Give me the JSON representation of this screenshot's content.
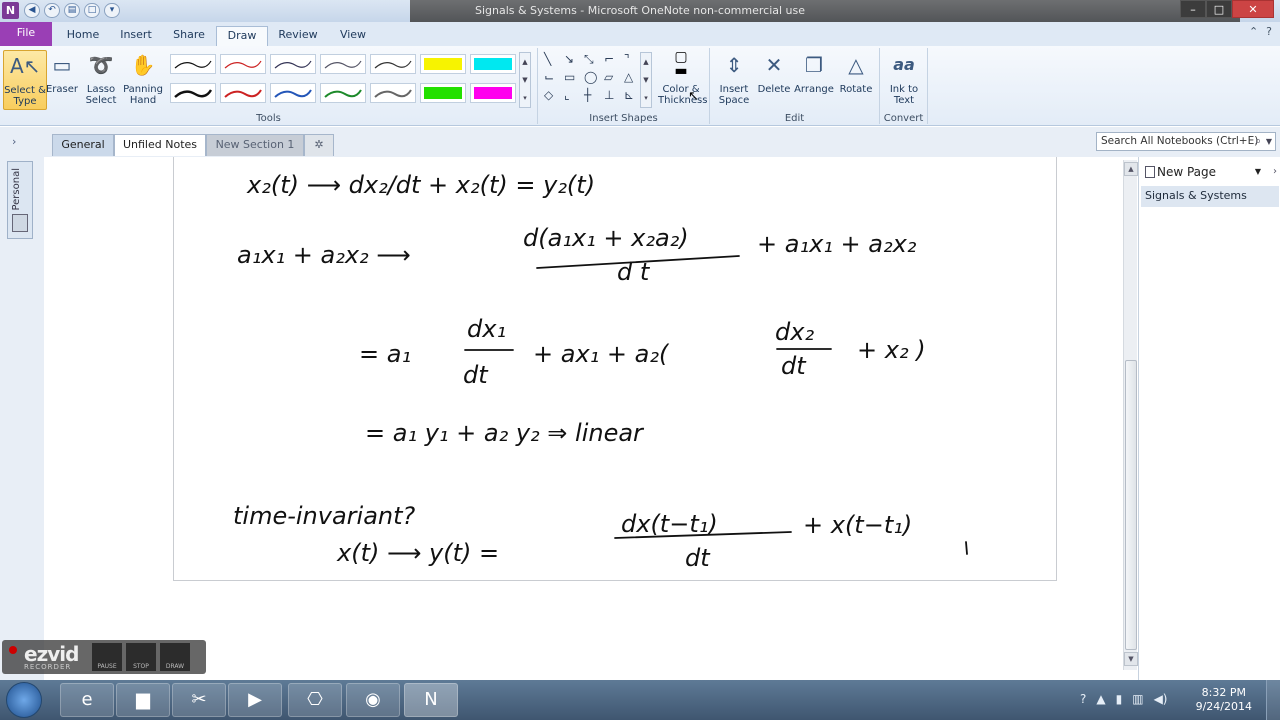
{
  "window": {
    "title": "Signals & Systems - Microsoft OneNote non-commercial use",
    "app_icon": "N"
  },
  "ribbon_tabs": [
    "File",
    "Home",
    "Insert",
    "Share",
    "Draw",
    "Review",
    "View"
  ],
  "active_tab": "Draw",
  "tools_group": {
    "label": "Tools",
    "select_type": "Select & Type",
    "eraser": "Eraser",
    "lasso_select": "Lasso Select",
    "panning_hand": "Panning Hand"
  },
  "insert_shapes_group": {
    "label": "Insert Shapes",
    "color_thickness": "Color & Thickness"
  },
  "edit_group": {
    "label": "Edit",
    "insert_space": "Insert Space",
    "delete": "Delete",
    "arrange": "Arrange",
    "rotate": "Rotate"
  },
  "convert_group": {
    "label": "Convert",
    "ink_to_text": "Ink to Text",
    "ink_icon_text": "aa"
  },
  "section_tabs": {
    "general": "General",
    "unfiled": "Unfiled Notes",
    "new_section": "New Section 1",
    "add": "✲"
  },
  "search": {
    "placeholder": "Search All Notebooks (Ctrl+E)"
  },
  "notebook_rail": {
    "label": "Personal"
  },
  "page_list": {
    "new_page": "New Page",
    "pages": [
      "Signals & Systems"
    ]
  },
  "ink_lines": [
    "x₂(t) ⟶ dx₂/dt + x₂(t) = y₂(t)",
    "a₁x₁ + a₂x₂ ⟶",
    "d(a₁x₁ + x₂a₂)",
    "d t",
    "+ a₁x₁ + a₂x₂",
    "= a₁",
    "dx₁",
    "dt",
    "+  ax₁ + a₂(",
    "dx₂",
    "dt",
    "+ x₂ )",
    "= a₁ y₁ + a₂ y₂ ⇒ linear",
    "time-invariant?",
    "x(t) ⟶ y(t) =",
    "dx(t−t₁)",
    "dt",
    "+  x(t−t₁)"
  ],
  "ezvid": {
    "logo": "ezvid",
    "sub": "RECORDER",
    "buttons": [
      "PAUSE",
      "STOP",
      "DRAW"
    ]
  },
  "taskbar": {
    "time": "8:32 PM",
    "date": "9/24/2014"
  },
  "colors": {
    "file_tab": "#9a3fb5",
    "ink": "#111111",
    "highlighter_yellow": "#f7f300",
    "highlighter_cyan": "#00e8f0",
    "highlighter_green": "#22e000",
    "highlighter_magenta": "#ff00ee"
  }
}
